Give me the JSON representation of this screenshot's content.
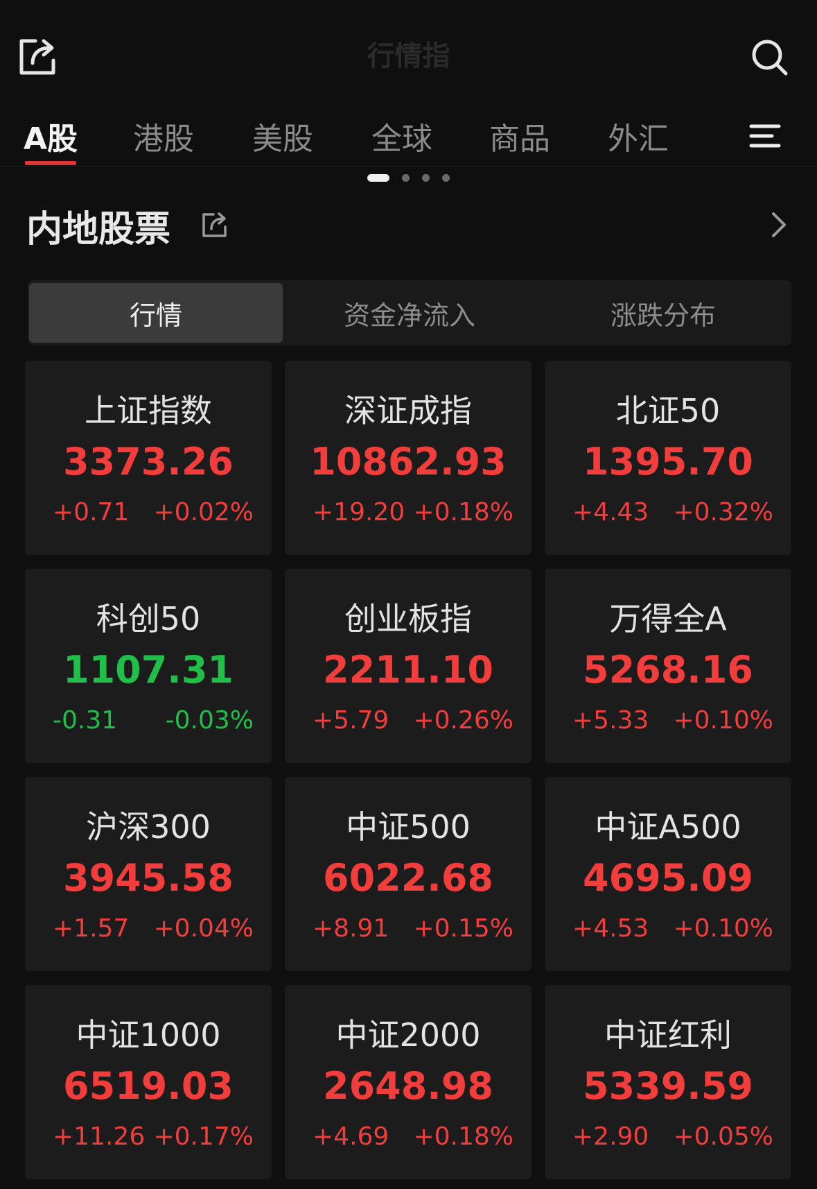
{
  "header": {
    "title": "行情指",
    "share_icon": "share-icon",
    "search_icon": "search-icon"
  },
  "tabs": [
    {
      "label": "A股",
      "active": true
    },
    {
      "label": "港股",
      "active": false
    },
    {
      "label": "美股",
      "active": false
    },
    {
      "label": "全球",
      "active": false
    },
    {
      "label": "商品",
      "active": false
    },
    {
      "label": "外汇",
      "active": false
    }
  ],
  "pager": {
    "count": 4,
    "active": 0
  },
  "section": {
    "title": "内地股票"
  },
  "segments": [
    {
      "label": "行情",
      "active": true
    },
    {
      "label": "资金净流入",
      "active": false
    },
    {
      "label": "涨跌分布",
      "active": false
    }
  ],
  "colors": {
    "up": "#f23d3d",
    "down": "#1fbf4a",
    "accent": "#e13434"
  },
  "indices": [
    {
      "name": "上证指数",
      "price": "3373.26",
      "change": "+0.71",
      "pct": "+0.02%",
      "direction": "up"
    },
    {
      "name": "深证成指",
      "price": "10862.93",
      "change": "+19.20",
      "pct": "+0.18%",
      "direction": "up"
    },
    {
      "name": "北证50",
      "price": "1395.70",
      "change": "+4.43",
      "pct": "+0.32%",
      "direction": "up"
    },
    {
      "name": "科创50",
      "price": "1107.31",
      "change": "-0.31",
      "pct": "-0.03%",
      "direction": "down"
    },
    {
      "name": "创业板指",
      "price": "2211.10",
      "change": "+5.79",
      "pct": "+0.26%",
      "direction": "up"
    },
    {
      "name": "万得全A",
      "price": "5268.16",
      "change": "+5.33",
      "pct": "+0.10%",
      "direction": "up"
    },
    {
      "name": "沪深300",
      "price": "3945.58",
      "change": "+1.57",
      "pct": "+0.04%",
      "direction": "up"
    },
    {
      "name": "中证500",
      "price": "6022.68",
      "change": "+8.91",
      "pct": "+0.15%",
      "direction": "up"
    },
    {
      "name": "中证A500",
      "price": "4695.09",
      "change": "+4.53",
      "pct": "+0.10%",
      "direction": "up"
    },
    {
      "name": "中证1000",
      "price": "6519.03",
      "change": "+11.26",
      "pct": "+0.17%",
      "direction": "up"
    },
    {
      "name": "中证2000",
      "price": "2648.98",
      "change": "+4.69",
      "pct": "+0.18%",
      "direction": "up"
    },
    {
      "name": "中证红利",
      "price": "5339.59",
      "change": "+2.90",
      "pct": "+0.05%",
      "direction": "up"
    }
  ]
}
